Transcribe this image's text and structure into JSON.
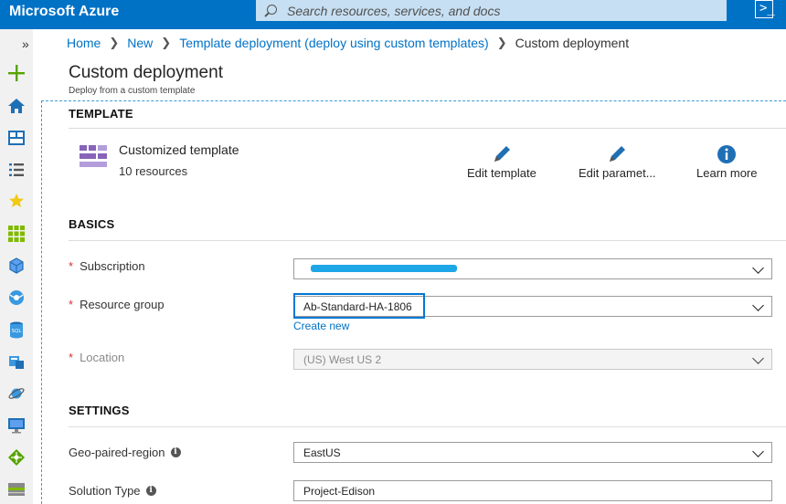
{
  "app": {
    "brand": "Microsoft Azure"
  },
  "search": {
    "placeholder": "Search resources, services, and docs"
  },
  "shell": {
    "icon": ">_"
  },
  "sidebar": {
    "expand": "»",
    "items": [
      "create-resource",
      "home",
      "dashboard",
      "all-services",
      "favorites",
      "all-resources",
      "resource-groups",
      "app-services",
      "sql-databases",
      "sql-server",
      "cosmos-db",
      "virtual-machines",
      "load-balancers",
      "storage-accounts"
    ]
  },
  "breadcrumb": {
    "items": [
      "Home",
      "New",
      "Template deployment (deploy using custom templates)"
    ],
    "current": "Custom deployment"
  },
  "page": {
    "title": "Custom deployment",
    "subtitle": "Deploy from a custom template"
  },
  "template": {
    "heading": "TEMPLATE",
    "name": "Customized template",
    "resources": "10 resources",
    "actions": {
      "edit_template": "Edit template",
      "edit_parameters": "Edit paramet...",
      "learn_more": "Learn more"
    }
  },
  "basics": {
    "heading": "BASICS",
    "subscription_label": "Subscription",
    "subscription_value": "",
    "resource_group_label": "Resource group",
    "resource_group_value": "Ab-Standard-HA-1806",
    "create_new": "Create new",
    "location_label": "Location",
    "location_value": "(US) West US 2"
  },
  "settings": {
    "heading": "SETTINGS",
    "geo_label": "Geo-paired-region",
    "geo_value": "EastUS",
    "solution_label": "Solution Type",
    "solution_value": "Project-Edison"
  },
  "colors": {
    "accent": "#0072c6",
    "required": "#d13438",
    "template_icon": "#8764b8"
  }
}
